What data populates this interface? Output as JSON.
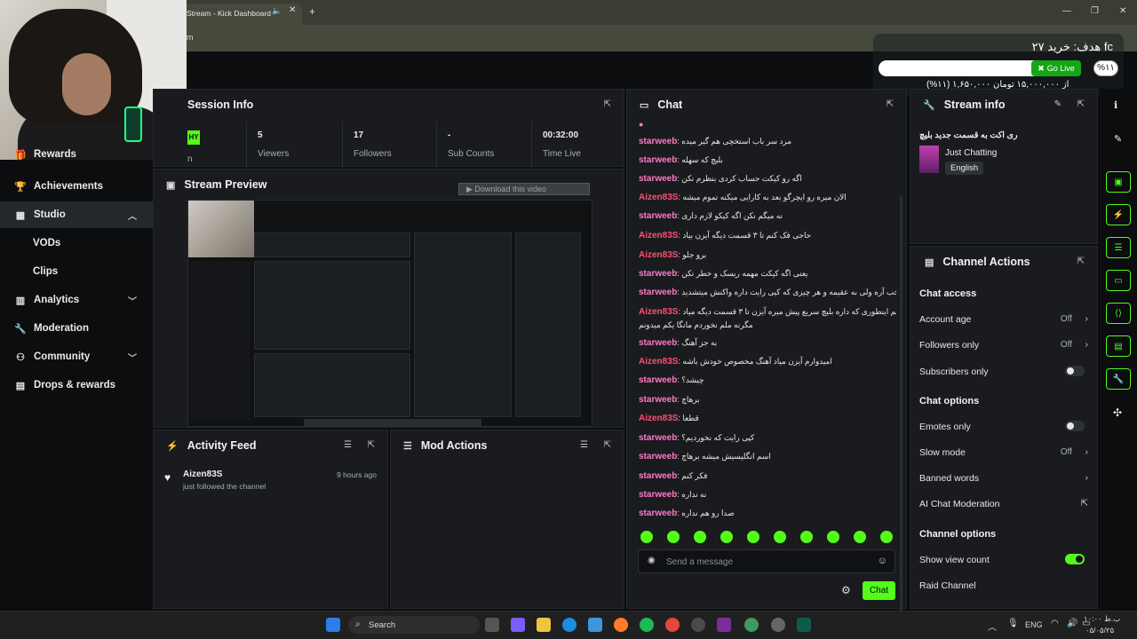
{
  "browser": {
    "tab_title": "Stream - Kick Dashboard",
    "tab_mute": "🔈",
    "tab_close": "✕",
    "new_tab": "+",
    "url_fragment": "m",
    "window_controls": [
      "—",
      "❐",
      "✕"
    ]
  },
  "goal_widget": {
    "title": "هدف: خرید ۲۷ fc",
    "go_live": "Go Live",
    "percent": "%۱۱",
    "progress": 0.11,
    "amount": "(%۱۱) ۱,۶۵۰,۰۰۰ از ۱۵,۰۰۰,۰۰۰ تومان"
  },
  "sidebar": {
    "items": [
      {
        "label": "Rewards",
        "icon": "gift-icon"
      },
      {
        "label": "Achievements",
        "icon": "trophy-icon"
      },
      {
        "label": "Studio",
        "icon": "studio-icon",
        "active": true
      },
      {
        "label": "VODs"
      },
      {
        "label": "Clips"
      },
      {
        "label": "Analytics",
        "icon": "analytics-icon"
      },
      {
        "label": "Moderation",
        "icon": "wrench-icon"
      },
      {
        "label": "Community",
        "icon": "community-icon"
      },
      {
        "label": "Drops & rewards",
        "icon": "drops-icon"
      }
    ]
  },
  "session_info": {
    "title": "Session Info",
    "badge": "HY",
    "first_label": "n",
    "stats": [
      {
        "value": "5",
        "label": "Viewers"
      },
      {
        "value": "17",
        "label": "Followers"
      },
      {
        "value": "-",
        "label": "Sub Counts"
      },
      {
        "value": "00:32:00",
        "label": "Time Live"
      }
    ]
  },
  "stream_preview": {
    "title": "Stream Preview",
    "download_label": "▶ Download this video"
  },
  "activity_feed": {
    "title": "Activity Feed",
    "items": [
      {
        "user": "Aizen83S",
        "text": "just followed the channel",
        "time": "9 hours ago"
      }
    ]
  },
  "mod_actions": {
    "title": "Mod Actions"
  },
  "chat": {
    "title": "Chat",
    "messages": [
      {
        "user": "starweeb",
        "text": "مرد سر باب استخچی هم گیر میده",
        "type": "sw"
      },
      {
        "user": "starweeb",
        "text": "بلیچ که سهله",
        "type": "sw"
      },
      {
        "user": "starweeb",
        "text": "اگه رو کیکت حساب کردی بنظرم نکن",
        "type": "sw"
      },
      {
        "user": "Aizen83S",
        "text": "الان میره رو ایچرگو بعد به کارایی میکنه تموم میشه",
        "type": "az"
      },
      {
        "user": "starweeb",
        "text": "نه میگم نکن اگه کیکو لازم داری",
        "type": "sw"
      },
      {
        "user": "Aizen83S",
        "text": "حاجی فک کنم تا ۳ قسمت دیگه آیزن بیاد",
        "type": "az"
      },
      {
        "user": "Aizen83S",
        "text": "برو جلو",
        "type": "az"
      },
      {
        "user": "starweeb",
        "text": "یعنی اگه کیکت مهمه ریسک و خطر نکن",
        "type": "sw"
      },
      {
        "user": "starweeb",
        "text": "خب آره ولی به عقیمه و هر چیزی که کیی رایت داره واکنش میتشدید",
        "type": "sw"
      },
      {
        "user": "Aizen83S",
        "text": "نه میگم اینطوری که داره بلیچ سریع پیش میره آیزن تا ۳ قسمت دیگه میاد",
        "type": "az"
      },
      {
        "user": "",
        "text": "مگرنه ملم نخوردم مانگا یکم میدونم",
        "type": "cont"
      },
      {
        "user": "starweeb",
        "text": "به جز آهنگ",
        "type": "sw"
      },
      {
        "user": "Aizen83S",
        "text": "امیدوارم آیزن میاد آهنگ مخصوص خودش باشه",
        "type": "az"
      },
      {
        "user": "starweeb",
        "text": "چیشد؟",
        "type": "sw"
      },
      {
        "user": "starweeb",
        "text": "برهاچ",
        "type": "sw"
      },
      {
        "user": "Aizen83S",
        "text": "قطعا",
        "type": "az"
      },
      {
        "user": "starweeb",
        "text": "کپی رایت که نخوردیم؟",
        "type": "sw"
      },
      {
        "user": "starweeb",
        "text": "اسم انگلیسیش میشه برهاچ",
        "type": "sw"
      },
      {
        "user": "starweeb",
        "text": "فکر کنم",
        "type": "sw"
      },
      {
        "user": "starweeb",
        "text": "نه نداره",
        "type": "sw"
      },
      {
        "user": "starweeb",
        "text": "صدا رو هم نداره",
        "type": "sw"
      }
    ],
    "input_placeholder": "Send a message",
    "send_label": "Chat"
  },
  "stream_info": {
    "title": "Stream info",
    "stream_title": "ری اکت به قسمت جدید بلیچ",
    "category": "Just Chatting",
    "language": "English"
  },
  "channel_actions": {
    "title": "Channel Actions",
    "chat_access_title": "Chat access",
    "account_age": {
      "label": "Account age",
      "value": "Off"
    },
    "followers_only": {
      "label": "Followers only",
      "value": "Off"
    },
    "subscribers_only": {
      "label": "Subscribers only",
      "on": false
    },
    "chat_options_title": "Chat options",
    "emotes_only": {
      "label": "Emotes only",
      "on": false
    },
    "slow_mode": {
      "label": "Slow mode",
      "value": "Off"
    },
    "banned_words": {
      "label": "Banned words"
    },
    "ai_moderation": {
      "label": "AI Chat Moderation"
    },
    "channel_options_title": "Channel options",
    "show_view_count": {
      "label": "Show view count",
      "on": true
    },
    "raid_channel": {
      "label": "Raid Channel"
    }
  },
  "taskbar": {
    "search_label": "Search",
    "lang": "ENG",
    "time": "۱۰:۰۰ ب.ظ",
    "date": "۰۵/۰۵/۲۵"
  },
  "colors": {
    "accent": "#53fc18",
    "starweeb": "#ff78c8",
    "aizen": "#ff4f6e",
    "panel": "#191b1e"
  }
}
